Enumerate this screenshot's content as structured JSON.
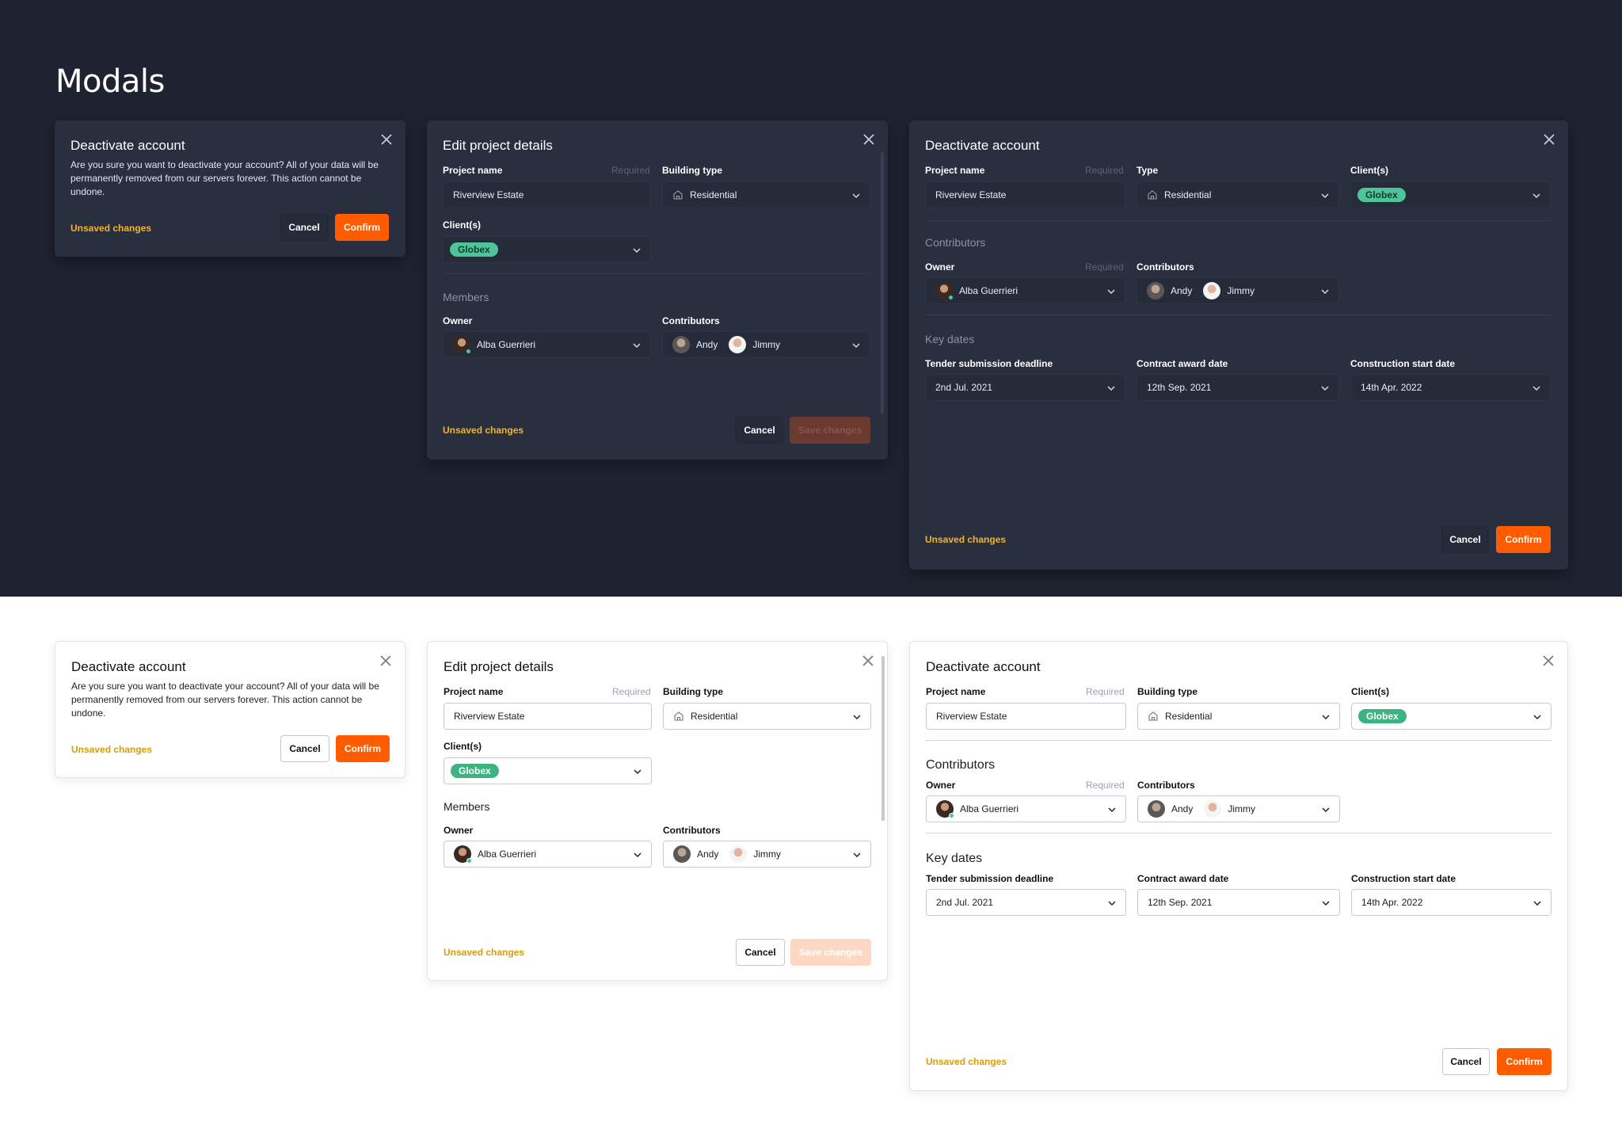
{
  "page_title": "Modals",
  "deactivate_small": {
    "title": "Deactivate account",
    "body": "Are you sure you want to deactivate your account? All of your data will be permanently removed from our servers forever. This action cannot be undone.",
    "unsaved": "Unsaved changes",
    "cancel": "Cancel",
    "confirm": "Confirm"
  },
  "edit_project": {
    "title": "Edit project details",
    "project_name_label": "Project name",
    "required": "Required",
    "project_name_value": "Riverview Estate",
    "building_type_label": "Building type",
    "building_type_value": "Residential",
    "clients_label": "Client(s)",
    "client_tag": "Globex",
    "members_section": "Members",
    "owner_label": "Owner",
    "owner_value": "Alba Guerrieri",
    "contributors_label": "Contributors",
    "contributor_1": "Andy",
    "contributor_2": "Jimmy",
    "unsaved": "Unsaved changes",
    "cancel": "Cancel",
    "save": "Save changes"
  },
  "deactivate_large": {
    "title": "Deactivate account",
    "project_name_label": "Project name",
    "required": "Required",
    "project_name_value": "Riverview Estate",
    "type_label_dark": "Type",
    "type_label_light": "Building type",
    "type_value": "Residential",
    "clients_label": "Client(s)",
    "client_tag": "Globex",
    "contributors_section": "Contributors",
    "owner_label": "Owner",
    "owner_value": "Alba Guerrieri",
    "contributors_label": "Contributors",
    "contributor_1": "Andy",
    "contributor_2": "Jimmy",
    "key_dates_section": "Key dates",
    "tender_label": "Tender submission deadline",
    "tender_value": "2nd Jul. 2021",
    "award_label": "Contract award date",
    "award_value": "12th Sep. 2021",
    "construction_label": "Construction start date",
    "construction_value": "14th Apr. 2022",
    "unsaved": "Unsaved changes",
    "cancel": "Cancel",
    "confirm": "Confirm"
  },
  "colors": {
    "dark_bg": "#1f2230",
    "dark_modal": "#2a2f40",
    "accent_orange": "#ff5c00",
    "unsaved_yellow": "#f0b429",
    "tag_green": "#4fc49a"
  },
  "icons": [
    "close-icon",
    "chevron-down-icon",
    "building-icon",
    "avatar",
    "online-dot"
  ]
}
